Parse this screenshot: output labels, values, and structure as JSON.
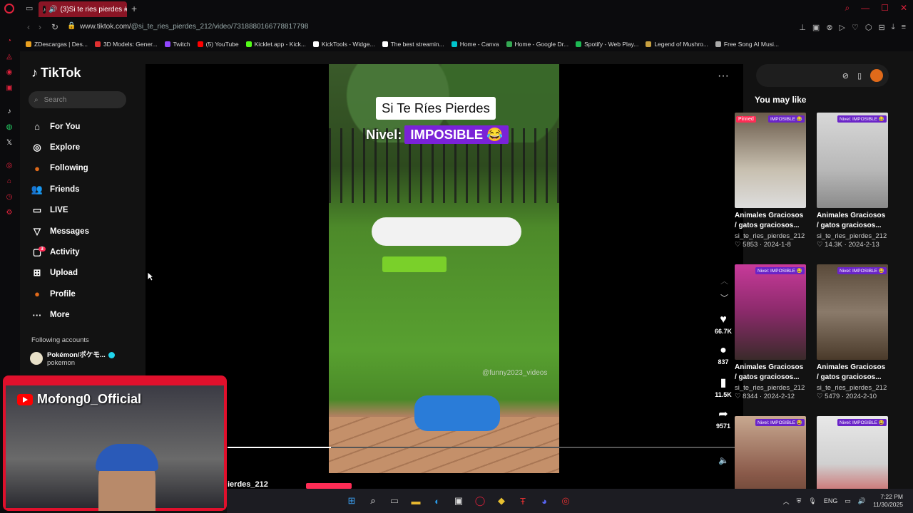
{
  "browser": {
    "tab_title": "(3)Si te ries pierdes #",
    "url_prefix": "www.tiktok.com/",
    "url_path": "@si_te_ries_pierdes_212/video/7318880166778817798",
    "bookmarks": [
      {
        "label": "ZDescargas | Des...",
        "color": "#e8a020"
      },
      {
        "label": "3D Models: Gener...",
        "color": "#e03030"
      },
      {
        "label": "Twitch",
        "color": "#9146ff"
      },
      {
        "label": "(5) YouTube",
        "color": "#ff0000"
      },
      {
        "label": "Kicklet.app - Kick...",
        "color": "#53fc18"
      },
      {
        "label": "KickTools - Widge...",
        "color": "#ffffff"
      },
      {
        "label": "The best streamin...",
        "color": "#ffffff"
      },
      {
        "label": "Home - Canva",
        "color": "#00c4cc"
      },
      {
        "label": "Home - Google Dr...",
        "color": "#34a853"
      },
      {
        "label": "Spotify - Web Play...",
        "color": "#1db954"
      },
      {
        "label": "Legend of Mushro...",
        "color": "#c8a040"
      },
      {
        "label": "Free Song AI Musi...",
        "color": "#aaaaaa"
      }
    ]
  },
  "tiktok": {
    "logo": "TikTok",
    "search_placeholder": "Search",
    "nav": [
      {
        "label": "For You",
        "icon": "home-icon",
        "glyph": "⌂"
      },
      {
        "label": "Explore",
        "icon": "compass-icon",
        "glyph": "◎"
      },
      {
        "label": "Following",
        "icon": "following-avatar-icon",
        "glyph": "●"
      },
      {
        "label": "Friends",
        "icon": "friends-icon",
        "glyph": "👥"
      },
      {
        "label": "LIVE",
        "icon": "live-icon",
        "glyph": "▭"
      },
      {
        "label": "Messages",
        "icon": "messages-icon",
        "glyph": "▽"
      },
      {
        "label": "Activity",
        "icon": "activity-icon",
        "glyph": "▢"
      },
      {
        "label": "Upload",
        "icon": "upload-icon",
        "glyph": "⊞"
      },
      {
        "label": "Profile",
        "icon": "profile-avatar-icon",
        "glyph": "●"
      },
      {
        "label": "More",
        "icon": "more-icon",
        "glyph": "···"
      }
    ],
    "activity_badge": "3",
    "following_title": "Following accounts",
    "following_account": {
      "name": "Pokémon/ポケモ...",
      "handle": "pokemon"
    },
    "video": {
      "title": "Si Te Ríes Pierdes",
      "level_label": "Nivel:",
      "level_value": "IMPOSIBLE 😂",
      "watermark": "@funny2023_videos",
      "progress": 0.2,
      "username_partial": "ierdes_212"
    },
    "actions": {
      "likes": "66.7K",
      "comments": "837",
      "saves": "11.5K",
      "shares": "9571"
    },
    "you_may_like": "You may like",
    "recommendations": [
      {
        "title": "Animales Graciosos / gatos graciosos...",
        "user": "si_te_ries_pierdes_212",
        "likes": "5853",
        "date": "2024-1-8",
        "pinned": "Pinned",
        "badge": "IMPOSIBLE 😂",
        "bg": "linear-gradient(180deg,#6a5a4a,#c8c0b0 60%,#ddd)"
      },
      {
        "title": "Animales Graciosos / gatos graciosos...",
        "user": "si_te_ries_pierdes_212",
        "likes": "14.3K",
        "date": "2024-2-13",
        "pinned": "",
        "badge": "Nivel: IMPOSIBLE 😂",
        "bg": "linear-gradient(180deg,#d8d8d8,#b8b8b8 60%,#8a8a8a)"
      },
      {
        "title": "Animales Graciosos / gatos graciosos...",
        "user": "si_te_ries_pierdes_212",
        "likes": "8344",
        "date": "2024-2-12",
        "pinned": "",
        "badge": "Nivel: IMPOSIBLE 😂",
        "bg": "linear-gradient(180deg,#c83a9a,#8a2a6a 50%,#3a2a2a)"
      },
      {
        "title": "Animales Graciosos / gatos graciosos...",
        "user": "si_te_ries_pierdes_212",
        "likes": "5479",
        "date": "2024-2-10",
        "pinned": "",
        "badge": "Nivel: IMPOSIBLE 😂",
        "bg": "linear-gradient(180deg,#5a4a3a,#8a7a6a 50%,#4a3a2a)"
      },
      {
        "title": "",
        "user": "",
        "likes": "",
        "date": "",
        "pinned": "",
        "badge": "Nivel: IMPOSIBLE 😂",
        "bg": "linear-gradient(180deg,#c8a890,#8a5a4a 60%,#5a3a2a)"
      },
      {
        "title": "",
        "user": "",
        "likes": "",
        "date": "",
        "pinned": "",
        "badge": "Nivel: IMPOSIBLE 😂",
        "bg": "linear-gradient(180deg,#e8e8e8,#d0d0d0 50%,#c83030)"
      }
    ]
  },
  "stream": {
    "channel": "Mofong0_Official"
  },
  "taskbar": {
    "language": "ENG",
    "time": "7:22 PM",
    "date": "11/30/2025"
  }
}
